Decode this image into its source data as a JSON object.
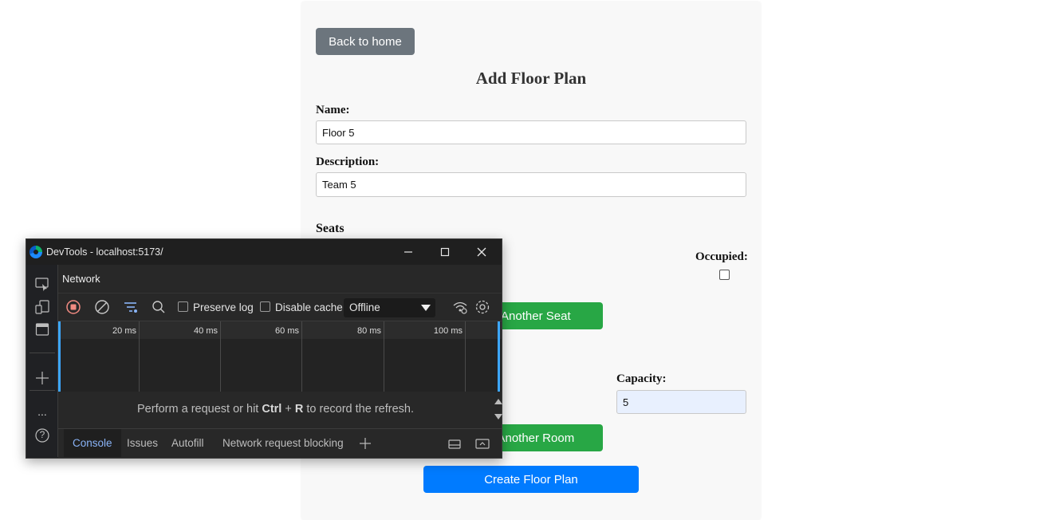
{
  "form": {
    "back_button": "Back to home",
    "title": "Add Floor Plan",
    "name_label": "Name:",
    "name_value": "Floor 5",
    "description_label": "Description:",
    "description_value": "Team 5",
    "seats_title": "Seats",
    "occupied_label": "Occupied:",
    "add_seat_button": "d Another Seat",
    "capacity_label": "Capacity:",
    "capacity_value": "5",
    "add_room_button": "d Another Room",
    "create_button": "Create Floor Plan"
  },
  "colors": {
    "back_button": "#6c757d",
    "green_button": "#28a745",
    "blue_button": "#007bff",
    "devtools_bg": "#202124",
    "active_tab": "#8ab4f8"
  },
  "devtools": {
    "window_title": "DevTools - localhost:5173/",
    "window_controls": [
      "minimize-icon",
      "maximize-icon",
      "close-icon"
    ],
    "panel_title": "Network",
    "toolbar": {
      "record_icon": "record-stop-icon",
      "clear_icon": "clear-icon",
      "filter_icon": "filter-icon",
      "search_icon": "search-icon",
      "preserve_log_label": "Preserve log",
      "preserve_log_checked": false,
      "disable_cache_label": "Disable cache",
      "disable_cache_checked": false,
      "throttling_value": "Offline",
      "network_conditions_icon": "network-conditions-icon",
      "settings_icon": "gear-icon"
    },
    "timeline_ticks": [
      "20 ms",
      "40 ms",
      "60 ms",
      "80 ms",
      "100 ms"
    ],
    "empty_message": {
      "before": "Perform a request or hit ",
      "key1": "Ctrl",
      "plus": " + ",
      "key2": "R",
      "after": " to record the refresh."
    },
    "drawer_tabs": [
      "Console",
      "Issues",
      "Autofill",
      "Network request blocking"
    ],
    "active_drawer_tab": "Console",
    "side_icons": [
      "inspect-icon",
      "device-toolbar-icon",
      "panel-icon",
      "add-icon",
      "more-icon",
      "help-icon"
    ],
    "side_more": "...",
    "side_help": "?"
  }
}
